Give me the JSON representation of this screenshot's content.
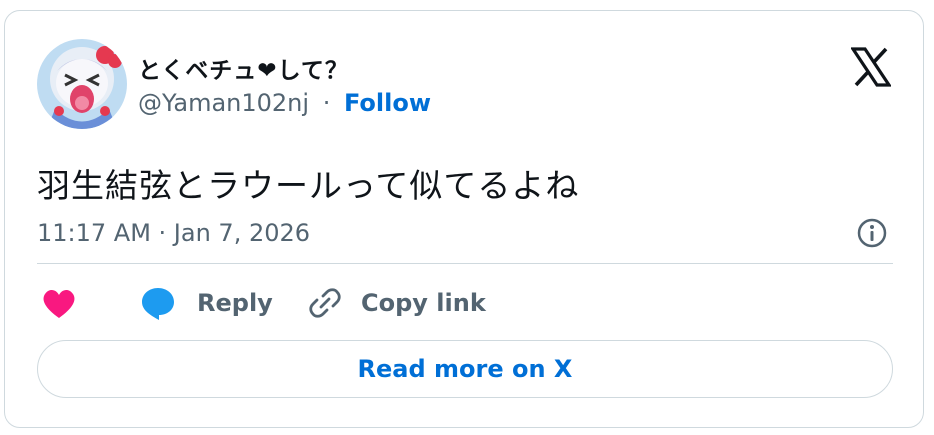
{
  "author": {
    "display_name": "とくベチュ❤して？",
    "handle": "@Yaman102nj",
    "separator": "·",
    "follow_label": "Follow",
    "avatar_icon": "anime-avatar-icon"
  },
  "brand": {
    "logo_icon": "x-logo-icon"
  },
  "tweet": {
    "text": "羽生結弦とラウールって似てるよね",
    "timestamp": "11:17 AM · Jan 7, 2026"
  },
  "actions": {
    "like_icon": "heart-icon",
    "reply_label": "Reply",
    "reply_icon": "speech-bubble-icon",
    "copy_link_label": "Copy link",
    "copy_link_icon": "link-icon",
    "info_icon": "info-icon"
  },
  "footer": {
    "read_more_label": "Read more on X"
  },
  "colors": {
    "accent": "#006fd6",
    "heart": "#f91880",
    "reply_bubble": "#1d9bf0",
    "muted_text": "#536471",
    "border": "#cfd9de"
  }
}
